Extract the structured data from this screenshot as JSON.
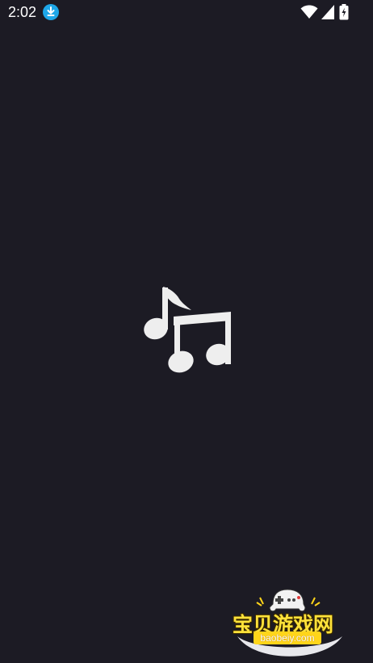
{
  "status_bar": {
    "time": "2:02",
    "icons": [
      "download-icon",
      "wifi-icon",
      "cellular-icon",
      "battery-charging-icon"
    ]
  },
  "splash": {
    "logo_icon": "music-notes-icon",
    "background_color": "#1c1b24",
    "logo_color": "#eeeeee"
  },
  "watermark": {
    "brand": "宝贝游戏网",
    "url": "baobeiy.com",
    "brand_color": "#ffe23a"
  }
}
